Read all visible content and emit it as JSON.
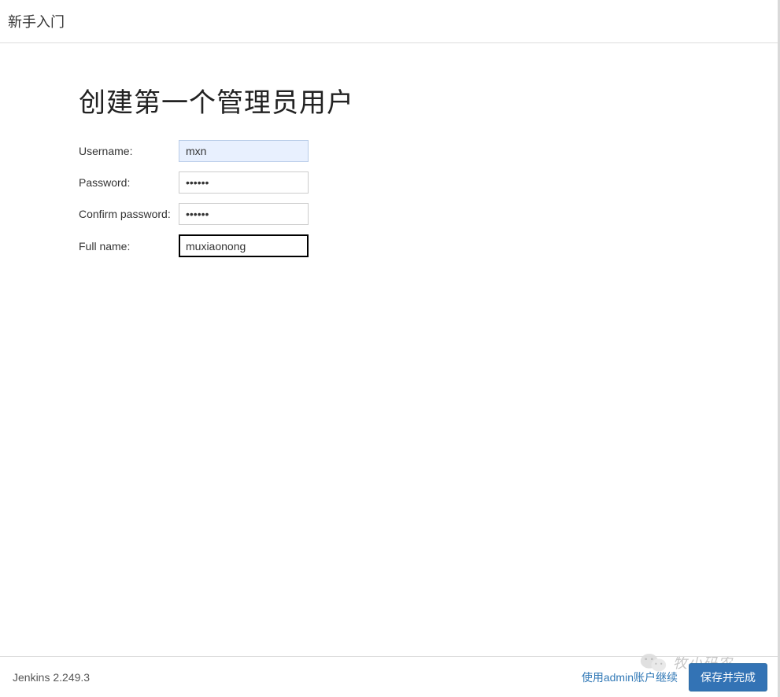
{
  "header": {
    "title": "新手入门"
  },
  "main": {
    "title": "创建第一个管理员用户",
    "fields": {
      "username": {
        "label": "Username:",
        "value": "mxn"
      },
      "password": {
        "label": "Password:",
        "value": "••••••"
      },
      "confirm_password": {
        "label": "Confirm password:",
        "value": "••••••"
      },
      "full_name": {
        "label": "Full name:",
        "value": "muxiaonong"
      }
    }
  },
  "footer": {
    "version": "Jenkins 2.249.3",
    "skip_label": "使用admin账户继续",
    "save_label": "保存并完成"
  },
  "watermark": {
    "text": "牧小码农"
  }
}
